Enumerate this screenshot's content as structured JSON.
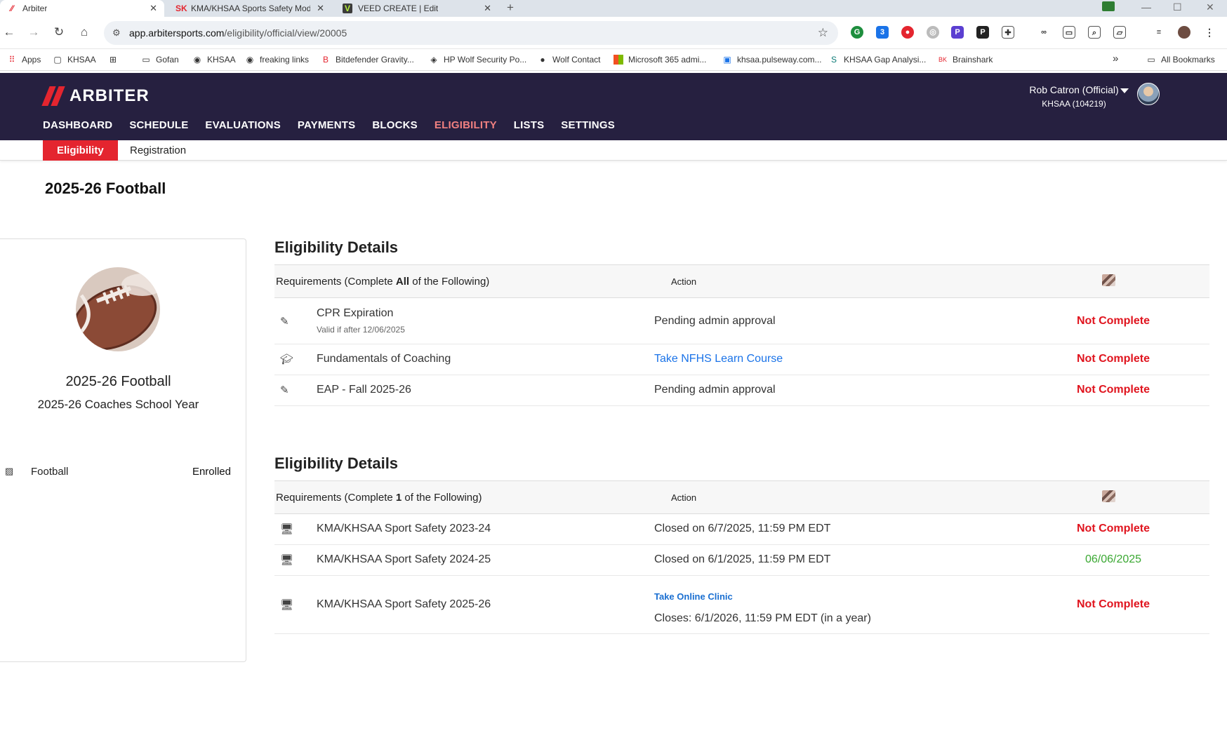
{
  "browser": {
    "tabs": [
      {
        "title": "Arbiter",
        "active": true
      },
      {
        "title": "KMA/KHSAA Sports Safety Mod",
        "active": false
      },
      {
        "title": "VEED CREATE | Edit",
        "active": false
      }
    ],
    "new_tab": "+",
    "url_host": "app.arbitersports.com",
    "url_path": "/eligibility/official/view/20005",
    "bookmarks": [
      "Apps",
      "KHSAA",
      "Gofan",
      "KHSAA",
      "freaking links",
      "Bitdefender Gravity...",
      "HP Wolf Security Po...",
      "Wolf Contact",
      "Microsoft 365 admi...",
      "khsaa.pulseway.com...",
      "KHSAA Gap Analysi...",
      "Brainshark"
    ],
    "bookmarks_more": "»",
    "all_bookmarks": "All Bookmarks",
    "ext_badge": "3"
  },
  "app": {
    "logo_text": "ARBITER",
    "nav": [
      "DASHBOARD",
      "SCHEDULE",
      "EVALUATIONS",
      "PAYMENTS",
      "BLOCKS",
      "ELIGIBILITY",
      "LISTS",
      "SETTINGS"
    ],
    "active_nav": "ELIGIBILITY",
    "user_name": "Rob Catron (Official)",
    "user_org": "KHSAA (104219)",
    "subtabs": [
      "Eligibility",
      "Registration"
    ]
  },
  "page": {
    "title": "2025-26 Football"
  },
  "profile": {
    "title": "2025-26 Football",
    "subtitle": "2025-26 Coaches School Year",
    "sport": "Football",
    "sport_status": "Enrolled"
  },
  "section1": {
    "heading": "Eligibility Details",
    "req_prefix": "Requirements (Complete ",
    "req_bold": "All",
    "req_suffix": " of the Following)",
    "action_header": "Action",
    "rows": [
      {
        "name": "CPR Expiration",
        "valid": "Valid if after 12/06/2025",
        "action": "Pending admin approval",
        "status": "Not Complete"
      },
      {
        "name": "Fundamentals of Coaching",
        "action": "Take NFHS Learn Course",
        "status": "Not Complete"
      },
      {
        "name": "EAP - Fall 2025-26",
        "action": "Pending admin approval",
        "status": "Not Complete"
      }
    ]
  },
  "section2": {
    "heading": "Eligibility Details",
    "req_prefix": "Requirements (Complete ",
    "req_bold": "1",
    "req_suffix": " of the Following)",
    "action_header": "Action",
    "rows": [
      {
        "name": "KMA/KHSAA Sport Safety 2023-24",
        "action": "Closed on 6/7/2025, 11:59 PM EDT",
        "status": "Not Complete"
      },
      {
        "name": "KMA/KHSAA Sport Safety 2024-25",
        "action": "Closed on 6/1/2025, 11:59 PM EDT",
        "status": "06/06/2025"
      },
      {
        "name": "KMA/KHSAA Sport Safety 2025-26",
        "action_link": "Take Online Clinic",
        "action": "Closes: 6/1/2026, 11:59 PM EDT (in a year)",
        "status": "Not Complete"
      }
    ]
  },
  "colors": {
    "header_bg": "#262040",
    "accent_red": "#e4252f",
    "status_red": "#e0141e",
    "status_green": "#3aa832",
    "link_blue": "#1a73e8"
  }
}
